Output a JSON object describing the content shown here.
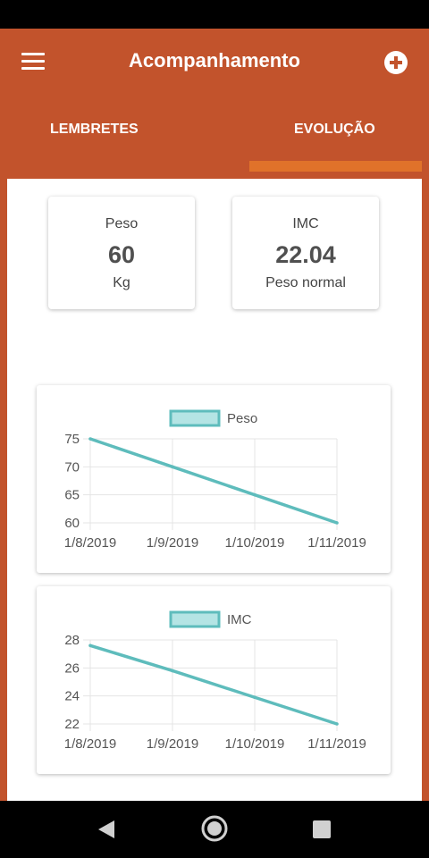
{
  "app_bar": {
    "title": "Acompanhamento",
    "menu_icon": "menu-icon",
    "add_icon": "add-circle-icon"
  },
  "tabs": [
    {
      "label": "LEMBRETES",
      "active": false
    },
    {
      "label": "EVOLUÇÃO",
      "active": true
    }
  ],
  "colors": {
    "primary": "#c2532c",
    "tab_indicator": "#e0722a",
    "chart_line": "#5ebcbc",
    "chart_fill": "#b4e4e4"
  },
  "stats": {
    "peso": {
      "label": "Peso",
      "value": "60",
      "unit": "Kg"
    },
    "imc": {
      "label": "IMC",
      "value": "22.04",
      "status": "Peso normal"
    }
  },
  "chart_data": [
    {
      "type": "line",
      "x": [
        "1/8/2019",
        "1/9/2019",
        "1/10/2019",
        "1/11/2019"
      ],
      "series": [
        {
          "name": "Peso",
          "values": [
            75,
            70,
            65,
            60
          ]
        }
      ],
      "ylim": [
        60,
        75
      ],
      "yticks": [
        75,
        70,
        65,
        60
      ],
      "grid": true,
      "legend": "top"
    },
    {
      "type": "line",
      "x": [
        "1/8/2019",
        "1/9/2019",
        "1/10/2019",
        "1/11/2019"
      ],
      "series": [
        {
          "name": "IMC",
          "values": [
            27.6,
            25.8,
            23.9,
            22.0
          ]
        }
      ],
      "ylim": [
        22,
        28
      ],
      "yticks": [
        28,
        26,
        24,
        22
      ],
      "grid": true,
      "legend": "top"
    }
  ],
  "nav": {
    "back_icon": "back-triangle-icon",
    "home_icon": "home-circle-icon",
    "recents_icon": "recents-square-icon"
  }
}
